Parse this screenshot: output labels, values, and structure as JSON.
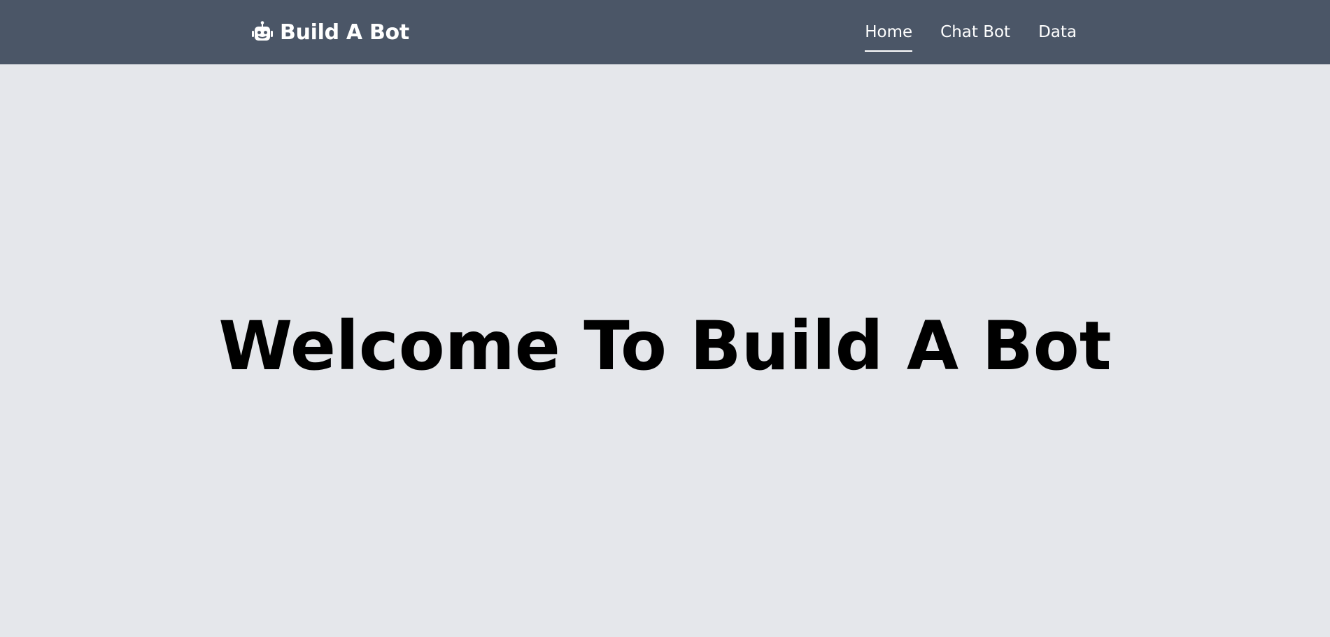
{
  "colors": {
    "navbar_bg": "#4b5667",
    "page_bg": "#e5e7eb",
    "nav_text": "#ffffff",
    "title_text": "#000000"
  },
  "header": {
    "brand_icon": "robot-icon",
    "brand_title": "Build A Bot",
    "nav": [
      {
        "label": "Home",
        "active": true
      },
      {
        "label": "Chat Bot",
        "active": false
      },
      {
        "label": "Data",
        "active": false
      }
    ]
  },
  "main": {
    "title": "Welcome To Build A Bot"
  }
}
